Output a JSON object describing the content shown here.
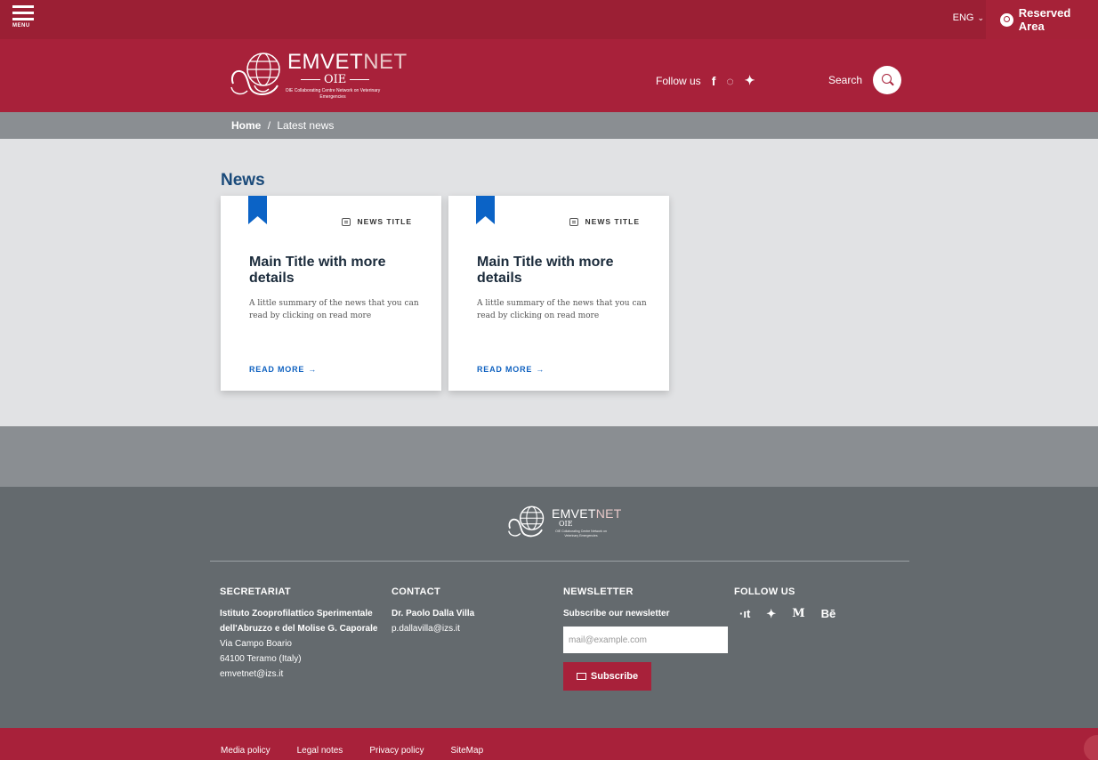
{
  "topbar": {
    "menu_label": "MENU",
    "lang": "ENG",
    "reserved_area": "Reserved Area"
  },
  "header": {
    "brand_em": "EMV",
    "brand_vet": "ET",
    "brand_net": "NET",
    "oie": "OIE",
    "tagline": "OIE Collaborating Centre Network on Veterinary Emergencies",
    "follow_label": "Follow us",
    "social": [
      "f",
      "github-icon",
      "twitter-icon"
    ],
    "search_label": "Search"
  },
  "breadcrumb": {
    "home": "Home",
    "separator": "/",
    "current": "Latest news"
  },
  "news": {
    "title": "News",
    "cards": [
      {
        "category": "NEWS TITLE",
        "title": "Main Title with more details",
        "summary": "A little summary of the news that you can read by clicking on read more",
        "read_more": "READ MORE",
        "arrow": "→"
      },
      {
        "category": "NEWS TITLE",
        "title": "Main Title with more details",
        "summary": "A little summary of the news that you can read by clicking on read more",
        "read_more": "READ MORE",
        "arrow": "→"
      }
    ]
  },
  "footer": {
    "secretariat": {
      "heading": "SECRETARIAT",
      "org": "Istituto Zooprofilattico Sperimentale dell'Abruzzo e del Molise G. Caporale",
      "address1": "Via Campo Boario",
      "address2": "64100 Teramo (Italy)",
      "email": "emvetnet@izs.it"
    },
    "contact": {
      "heading": "CONTACT",
      "name": "Dr. Paolo Dalla Villa",
      "email": "p.dallavilla@izs.it"
    },
    "newsletter": {
      "heading": "NEWSLETTER",
      "text": "Subscribe our newsletter",
      "placeholder": "mail@example.com",
      "button": "Subscribe"
    },
    "follow": {
      "heading": "FOLLOW US",
      "icons": [
        "·ıt",
        "🐦",
        "M",
        "Bē"
      ]
    },
    "links": [
      "Media policy",
      "Legal notes",
      "Privacy policy",
      "SiteMap"
    ]
  },
  "colors": {
    "topbar": "#9b1f34",
    "header": "#a8213a",
    "accent_blue": "#0b63c6",
    "footer": "#646a6e"
  }
}
